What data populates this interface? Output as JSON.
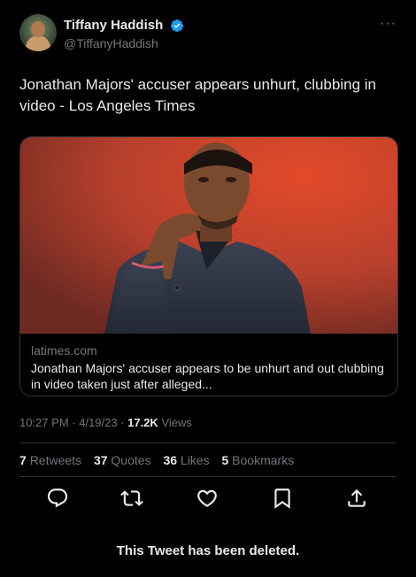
{
  "tweet": {
    "author_name": "Tiffany Haddish",
    "author_handle": "@TiffanyHaddish",
    "text": "Jonathan Majors' accuser appears unhurt, clubbing in video - Los Angeles Times",
    "card": {
      "domain": "latimes.com",
      "description": "Jonathan Majors' accuser appears to be unhurt and out clubbing in video taken just after alleged..."
    },
    "timestamp": "10:27 PM · 4/19/23 · ",
    "views_count": "17.2K",
    "views_label": " Views",
    "stats": [
      {
        "count": "7",
        "label": "Retweets"
      },
      {
        "count": "37",
        "label": "Quotes"
      },
      {
        "count": "36",
        "label": "Likes"
      },
      {
        "count": "5",
        "label": "Bookmarks"
      }
    ]
  },
  "icons": {
    "verified": "verified-badge-icon",
    "more": "more-icon",
    "reply": "reply-icon",
    "retweet": "retweet-icon",
    "like": "like-icon",
    "bookmark": "bookmark-icon",
    "share": "share-icon"
  },
  "colors": {
    "background": "#000000",
    "primary_text": "#e7e9ea",
    "secondary_text": "#71767b",
    "verified_blue": "#1d9bf0",
    "border": "#2f3336"
  },
  "more_glyph": "···",
  "deleted_notice": "This Tweet has been deleted."
}
